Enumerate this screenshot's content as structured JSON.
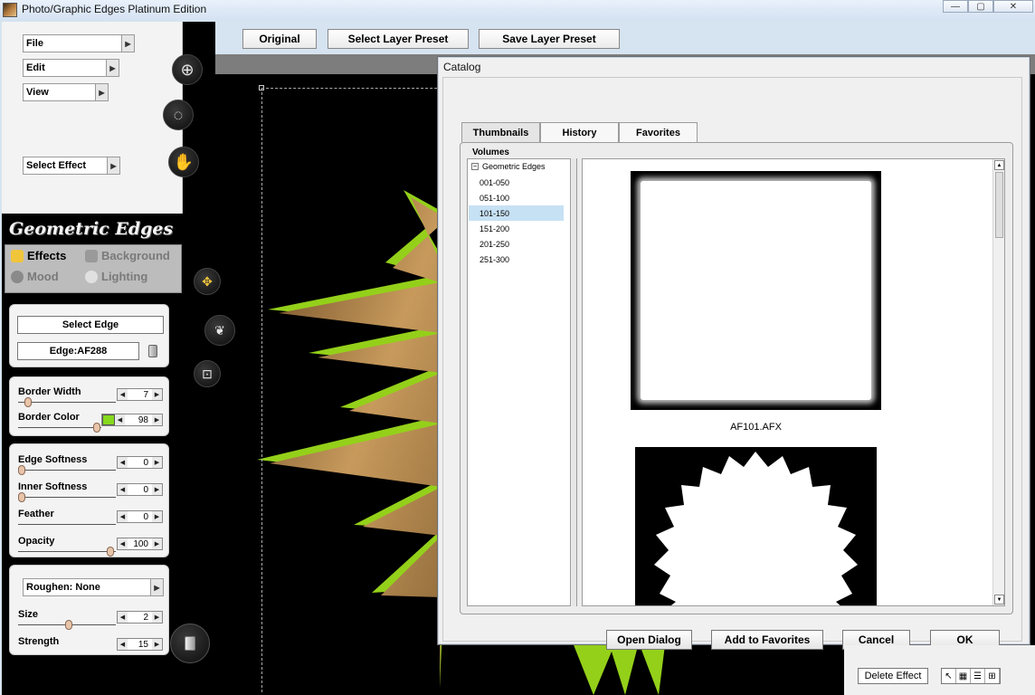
{
  "window": {
    "title": "Photo/Graphic Edges Platinum Edition",
    "minimize": "—",
    "maximize": "▢",
    "close": "✕"
  },
  "menu": {
    "file": "File",
    "edit": "Edit",
    "view": "View",
    "select_effect": "Select Effect"
  },
  "tools": {
    "zoom": "zoom-in-icon",
    "loading": "spinner-icon",
    "hand": "hand-icon"
  },
  "panel": {
    "title": "Geometric Edges",
    "tabs": {
      "effects": "Effects",
      "background": "Background",
      "mood": "Mood",
      "lighting": "Lighting"
    },
    "select_edge": "Select Edge",
    "edge_value": "Edge:AF288",
    "border_width": {
      "label": "Border Width",
      "value": "7"
    },
    "border_color": {
      "label": "Border Color",
      "value": "98",
      "color": "#86d91e"
    },
    "edge_softness": {
      "label": "Edge Softness",
      "value": "0"
    },
    "inner_softness": {
      "label": "Inner Softness",
      "value": "0"
    },
    "feather": {
      "label": "Feather",
      "value": "0"
    },
    "opacity": {
      "label": "Opacity",
      "value": "100"
    },
    "roughen": "Roughen: None",
    "size": {
      "label": "Size",
      "value": "2"
    },
    "strength": {
      "label": "Strength",
      "value": "15"
    }
  },
  "toolbar": {
    "original": "Original",
    "select_preset": "Select Layer Preset",
    "save_preset": "Save Layer Preset"
  },
  "catalog": {
    "title": "Catalog",
    "tabs": [
      "Thumbnails",
      "History",
      "Favorites"
    ],
    "volumes_label": "Volumes",
    "tree_root": "Geometric Edges",
    "tree_items": [
      "001-050",
      "051-100",
      "101-150",
      "151-200",
      "201-250",
      "251-300"
    ],
    "selected_item": "101-150",
    "thumb_label": "AF101.AFX",
    "buttons": {
      "open": "Open Dialog",
      "add_fav": "Add to Favorites",
      "cancel": "Cancel",
      "ok": "OK"
    }
  },
  "bottom": {
    "delete_effect": "Delete Effect"
  }
}
